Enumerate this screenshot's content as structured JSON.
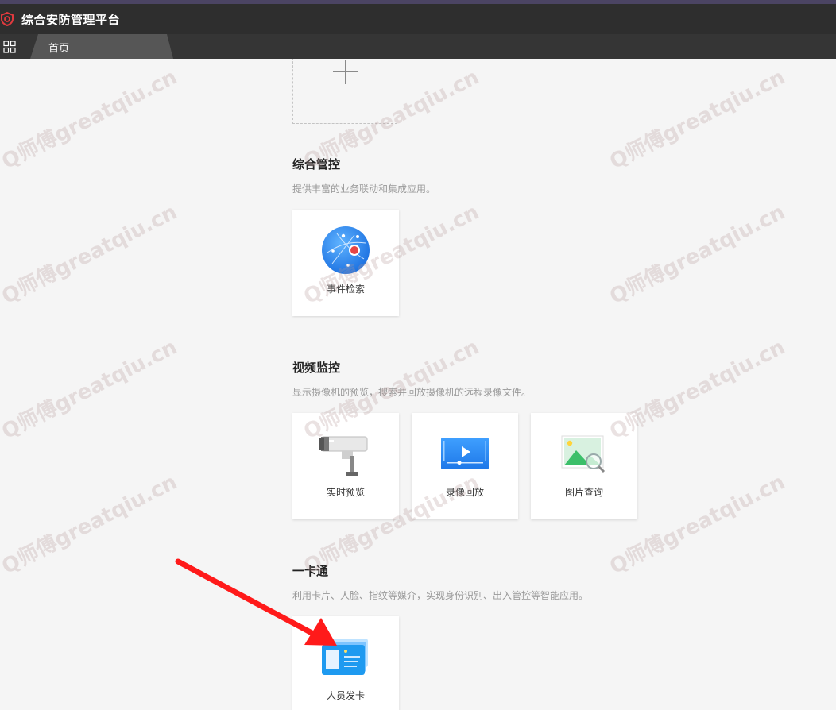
{
  "app": {
    "title": "综合安防管理平台"
  },
  "tabs": [
    {
      "label": "首页"
    }
  ],
  "sections": [
    {
      "title": "综合管控",
      "desc": "提供丰富的业务联动和集成应用。",
      "cards": [
        {
          "label": "事件检索",
          "icon": "globe-network-icon"
        }
      ]
    },
    {
      "title": "视频监控",
      "desc": "显示摄像机的预览，搜索并回放摄像机的远程录像文件。",
      "cards": [
        {
          "label": "实时预览",
          "icon": "camera-icon"
        },
        {
          "label": "录像回放",
          "icon": "video-playback-icon"
        },
        {
          "label": "图片查询",
          "icon": "image-search-icon"
        }
      ]
    },
    {
      "title": "一卡通",
      "desc": "利用卡片、人脸、指纹等媒介，实现身份识别、出入管控等智能应用。",
      "cards": [
        {
          "label": "人员发卡",
          "icon": "id-card-icon"
        }
      ]
    }
  ],
  "watermark": {
    "text": "Q师傅greatqiu.cn"
  },
  "colors": {
    "brand": "#e03a3e",
    "titlebar": "#2e2e2e",
    "accent": "#ff0000"
  }
}
